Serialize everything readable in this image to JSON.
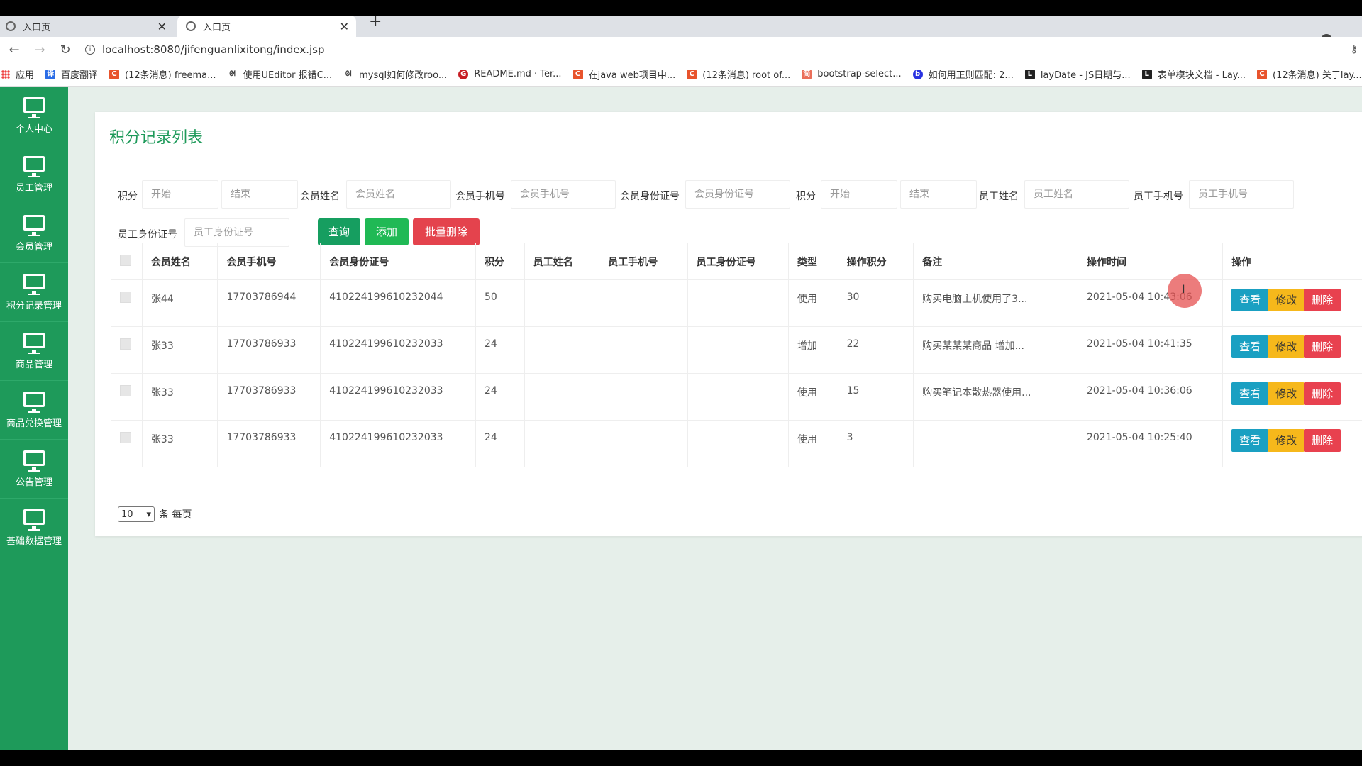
{
  "browser": {
    "tabs": [
      {
        "label": "入口页"
      },
      {
        "label": "入口页"
      }
    ],
    "new_tab": "+",
    "url": "localhost:8080/jifenguanlixitong/index.jsp",
    "bookmarks": [
      {
        "label": "应用",
        "icon": "apps-grid-icon"
      },
      {
        "label": "百度翻译",
        "icon": "baidu-translate-icon",
        "color": "#2b6de6"
      },
      {
        "label": "(12条消息) freema...",
        "icon": "csdn-icon",
        "color": "#e8532c"
      },
      {
        "label": "使用UEditor 报错C...",
        "icon": "link-icon",
        "color": "#444444"
      },
      {
        "label": "mysql如何修改roo...",
        "icon": "link-icon",
        "color": "#444444"
      },
      {
        "label": "README.md · Ter...",
        "icon": "gitee-icon",
        "color": "#c71d23"
      },
      {
        "label": "在java web项目中...",
        "icon": "csdn-icon",
        "color": "#e8532c"
      },
      {
        "label": "(12条消息) root of...",
        "icon": "csdn-icon",
        "color": "#e8532c"
      },
      {
        "label": "bootstrap-select...",
        "icon": "jianshu-icon",
        "color": "#ea6f5a"
      },
      {
        "label": "如何用正则匹配: 2...",
        "icon": "baidu-icon",
        "color": "#2932e1"
      },
      {
        "label": "layDate - JS日期与...",
        "icon": "layui-icon",
        "color": "#222222"
      },
      {
        "label": "表单模块文档 - Lay...",
        "icon": "layui-icon",
        "color": "#222222"
      },
      {
        "label": "(12条消息) 关于lay...",
        "icon": "csdn-icon",
        "color": "#e8532c"
      }
    ]
  },
  "sidebar": {
    "items": [
      {
        "label": "个人中心"
      },
      {
        "label": "员工管理"
      },
      {
        "label": "会员管理"
      },
      {
        "label": "积分记录管理"
      },
      {
        "label": "商品管理"
      },
      {
        "label": "商品兑换管理"
      },
      {
        "label": "公告管理"
      },
      {
        "label": "基础数据管理"
      }
    ]
  },
  "panel": {
    "title": "积分记录列表",
    "filters": {
      "points_label": "积分",
      "points_start_placeholder": "开始",
      "points_end_placeholder": "结束",
      "member_name_label": "会员姓名",
      "member_name_placeholder": "会员姓名",
      "member_phone_label": "会员手机号",
      "member_phone_placeholder": "会员手机号",
      "member_id_label": "会员身份证号",
      "member_id_placeholder": "会员身份证号",
      "points2_label": "积分",
      "points2_start_placeholder": "开始",
      "points2_end_placeholder": "结束",
      "staff_name_label": "员工姓名",
      "staff_name_placeholder": "员工姓名",
      "staff_phone_label": "员工手机号",
      "staff_phone_placeholder": "员工手机号",
      "staff_id_label": "员工身份证号",
      "staff_id_placeholder": "员工身份证号"
    },
    "buttons": {
      "query": "查询",
      "add": "添加",
      "batch_delete": "批量删除"
    },
    "table": {
      "headers": [
        "会员姓名",
        "会员手机号",
        "会员身份证号",
        "积分",
        "员工姓名",
        "员工手机号",
        "员工身份证号",
        "类型",
        "操作积分",
        "备注",
        "操作时间",
        "操作"
      ],
      "rows": [
        {
          "member_name": "张44",
          "member_phone": "17703786944",
          "member_id": "410224199610232044",
          "points": "50",
          "staff_name": "",
          "staff_phone": "",
          "staff_id": "",
          "type": "使用",
          "op_points": "30",
          "note": "购买电脑主机使用了3...",
          "time": "2021-05-04 10:43:06"
        },
        {
          "member_name": "张33",
          "member_phone": "17703786933",
          "member_id": "410224199610232033",
          "points": "24",
          "staff_name": "",
          "staff_phone": "",
          "staff_id": "",
          "type": "增加",
          "op_points": "22",
          "note": "购买某某某商品 增加...",
          "time": "2021-05-04 10:41:35"
        },
        {
          "member_name": "张33",
          "member_phone": "17703786933",
          "member_id": "410224199610232033",
          "points": "24",
          "staff_name": "",
          "staff_phone": "",
          "staff_id": "",
          "type": "使用",
          "op_points": "15",
          "note": "购买笔记本散热器使用...",
          "time": "2021-05-04 10:36:06"
        },
        {
          "member_name": "张33",
          "member_phone": "17703786933",
          "member_id": "410224199610232033",
          "points": "24",
          "staff_name": "",
          "staff_phone": "",
          "staff_id": "",
          "type": "使用",
          "op_points": "3",
          "note": "",
          "time": "2021-05-04 10:25:40"
        }
      ],
      "row_actions": {
        "view": "查看",
        "edit": "修改",
        "delete": "删除"
      }
    },
    "pagination": {
      "page_size": "10",
      "page_size_suffix": "条 每页"
    }
  },
  "colors": {
    "brand_green": "#1e9a5a",
    "view_button": "#1aa0c2",
    "edit_button": "#f6b81b",
    "delete_button": "#e8414f"
  }
}
